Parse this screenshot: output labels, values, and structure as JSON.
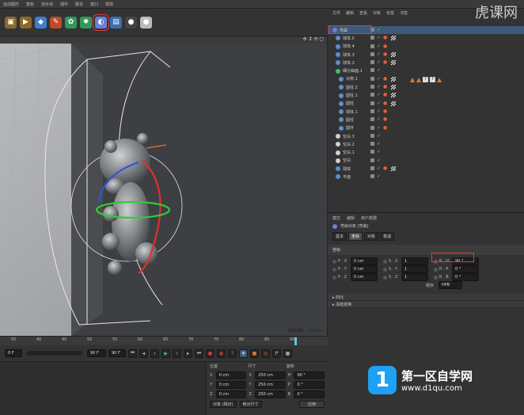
{
  "menubar": [
    "运动图形",
    "角色",
    "流水线",
    "插件",
    "脚本",
    "窗口",
    "帮助"
  ],
  "toolbar": {
    "buttons": [
      {
        "name": "film-icon",
        "glyph": "▣",
        "color": "#8a6a2a"
      },
      {
        "name": "film-play-icon",
        "glyph": "▶",
        "color": "#8a6a2a"
      },
      {
        "name": "cube-icon",
        "glyph": "◆",
        "color": "#3c7fd1"
      },
      {
        "name": "pen-icon",
        "glyph": "✎",
        "color": "#c04a2a"
      },
      {
        "name": "subdivide-icon",
        "glyph": "✿",
        "color": "#2f9a5a"
      },
      {
        "name": "array-icon",
        "glyph": "✹",
        "color": "#2f9a5a"
      },
      {
        "name": "deformer-icon",
        "glyph": "◐",
        "color": "#6b7fd9",
        "selected": true
      },
      {
        "name": "floor-icon",
        "glyph": "▤",
        "color": "#3a6fb0"
      },
      {
        "name": "camera-icon",
        "glyph": "●",
        "color": "#444"
      },
      {
        "name": "light-icon",
        "glyph": "●",
        "color": "#bbb"
      }
    ]
  },
  "viewport": {
    "nav_glyphs": "✣ ↕ ⟲ ▢",
    "grid_label": "网格间距 : 100 cm"
  },
  "timeline": {
    "ticks": [
      "55",
      "40",
      "45",
      "50",
      "55",
      "60",
      "65",
      "70",
      "75",
      "80",
      "85",
      "90"
    ],
    "frame_field": "90 F",
    "end_field": "90 F",
    "current_frame": "0 F"
  },
  "coords": {
    "headers": [
      "位置",
      "尺寸",
      "旋转"
    ],
    "rows": [
      {
        "axis": "X",
        "pos": "0 cm",
        "size": "250 cm",
        "rot_axis": "H",
        "rot": "90 °"
      },
      {
        "axis": "Y",
        "pos": "0 cm",
        "size": "250 cm",
        "rot_axis": "P",
        "rot": "0 °"
      },
      {
        "axis": "Z",
        "pos": "0 cm",
        "size": "250 cm",
        "rot_axis": "B",
        "rot": "0 °"
      }
    ],
    "mode_object": "对象 (相对)",
    "mode_size": "绝对尺寸",
    "apply": "应用"
  },
  "objmgr": {
    "menu": [
      "文件",
      "编辑",
      "查看",
      "对象",
      "标签",
      "书签"
    ],
    "rows": [
      {
        "name": "弯曲",
        "icon": "#6b7fd9",
        "selected": true,
        "mat": false,
        "grid": false
      },
      {
        "name": "球体.5",
        "icon": "#5b8fd1",
        "mat": true,
        "grid": true
      },
      {
        "name": "球体.4",
        "icon": "#5b8fd1",
        "mat": true,
        "grid": false
      },
      {
        "name": "球体.3",
        "icon": "#5b8fd1",
        "mat": true,
        "grid": true
      },
      {
        "name": "球体.2",
        "icon": "#5b8fd1",
        "mat": true,
        "grid": true
      },
      {
        "name": "细分曲面.1",
        "icon": "#3fbf6f",
        "mat": false,
        "grid": false
      },
      {
        "name": "对称.1",
        "icon": "#5b8fd1",
        "mat": true,
        "grid": true,
        "extras": true
      },
      {
        "name": "圆柱.2",
        "icon": "#5b8fd1",
        "mat": true,
        "grid": true
      },
      {
        "name": "圆柱.1",
        "icon": "#5b8fd1",
        "mat": true,
        "grid": true
      },
      {
        "name": "圆柱",
        "icon": "#5b8fd1",
        "mat": true,
        "grid": true
      },
      {
        "name": "球体.1",
        "icon": "#5b8fd1",
        "mat": true,
        "grid": false
      },
      {
        "name": "圆柱",
        "icon": "#5b8fd1",
        "mat": true,
        "grid": false
      },
      {
        "name": "圆环",
        "icon": "#5b8fd1",
        "mat": true,
        "grid": false
      },
      {
        "name": "空白.3",
        "icon": "#d2d2d2",
        "mat": false,
        "grid": false
      },
      {
        "name": "空白.2",
        "icon": "#d2d2d2",
        "mat": false,
        "grid": false
      },
      {
        "name": "空白.1",
        "icon": "#d2d2d2",
        "mat": false,
        "grid": false
      },
      {
        "name": "空白",
        "icon": "#d2d2d2",
        "mat": false,
        "grid": false
      },
      {
        "name": "球体",
        "icon": "#5b8fd1",
        "mat": true,
        "grid": true
      },
      {
        "name": "平面",
        "icon": "#5b8fd1",
        "mat": false,
        "grid": false
      }
    ]
  },
  "attr": {
    "menu": [
      "模式",
      "编辑",
      "用户数据"
    ],
    "object_title": "弯曲对象 [弯曲]",
    "tabs": [
      "基本",
      "坐标",
      "对象",
      "衰减"
    ],
    "active_tab": 1,
    "section": "坐标",
    "rows": [
      {
        "p_k": "P . X",
        "p_v": "0 cm",
        "s_k": "S . X",
        "s_v": "1",
        "r_k": "R . H",
        "r_v": "90 °"
      },
      {
        "p_k": "P . Y",
        "p_v": "0 cm",
        "s_k": "S . Y",
        "s_v": "1",
        "r_k": "R . P",
        "r_v": "0 °"
      },
      {
        "p_k": "P . Z",
        "p_v": "0 cm",
        "s_k": "S . Z",
        "s_v": "1",
        "r_k": "R . B",
        "r_v": "0 °"
      }
    ],
    "order_label": "顺序",
    "order_value": "HPB",
    "fold1": "▸ 四元",
    "fold2": "▸ 冻结变换"
  },
  "watermarks": {
    "top": "虎课网",
    "logo": "1",
    "bottom_main": "第一区自学网",
    "bottom_url": "www.d1qu.com"
  }
}
